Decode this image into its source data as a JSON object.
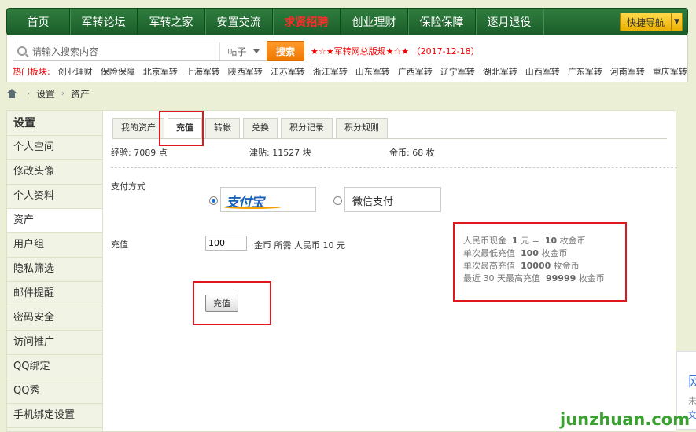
{
  "nav": {
    "items": [
      "首页",
      "军转论坛",
      "军转之家",
      "安置交流",
      "求贤招聘",
      "创业理财",
      "保险保障",
      "逐月退役"
    ],
    "hot_index": 4,
    "quick_nav": "快捷导航"
  },
  "search": {
    "placeholder": "请输入搜索内容",
    "type": "帖子",
    "button": "搜索",
    "notice": "★☆★军转网总版规★☆★ （2017-12-18）"
  },
  "hot": {
    "label": "热门板块:",
    "items": [
      "创业理财",
      "保险保障",
      "北京军转",
      "上海军转",
      "陕西军转",
      "江苏军转",
      "浙江军转",
      "山东军转",
      "广西军转",
      "辽宁军转",
      "湖北军转",
      "山西军转",
      "广东军转",
      "河南军转",
      "重庆军转"
    ]
  },
  "breadcrumb": {
    "items": [
      "设置",
      "资产"
    ],
    "separator": "›"
  },
  "sidebar": {
    "title": "设置",
    "items": [
      "个人空间",
      "修改头像",
      "个人资料",
      "资产",
      "用户组",
      "隐私筛选",
      "邮件提醒",
      "密码安全",
      "访问推广",
      "QQ绑定",
      "QQ秀",
      "手机绑定设置"
    ],
    "active_index": 3
  },
  "tabs": {
    "items": [
      "我的资产",
      "充值",
      "转帐",
      "兑换",
      "积分记录",
      "积分规则"
    ],
    "active_index": 1
  },
  "stats": {
    "exp": "经验: 7089 点",
    "allowance": "津贴: 11527 块",
    "gold": "金币: 68 枚"
  },
  "payment": {
    "label": "支付方式",
    "alipay": "支付宝",
    "wechat": "微信支付"
  },
  "recharge": {
    "label": "充值",
    "amount": "100",
    "unit_text": "金币  所需 人民币 10 元",
    "button": "充值"
  },
  "info": {
    "line1_a": "人民币现金",
    "line1_b": "1",
    "line1_c": "元 =",
    "line1_d": "10",
    "line1_e": "枚金币",
    "line2_a": "单次最低充值",
    "line2_b": "100",
    "line2_c": "枚金币",
    "line3_a": "单次最高充值",
    "line3_b": "10000",
    "line3_c": "枚金币",
    "line4_a": "最近 30 天最高充值",
    "line4_b": "99999",
    "line4_c": "枚金币"
  },
  "widget": {
    "t1": "网",
    "t2": "未",
    "t3": "文"
  },
  "watermark": "junzhuan.com",
  "colors": {
    "nav_bg": "#1b5d2a",
    "highlight": "#e0181e",
    "search_btn": "#f07800"
  }
}
